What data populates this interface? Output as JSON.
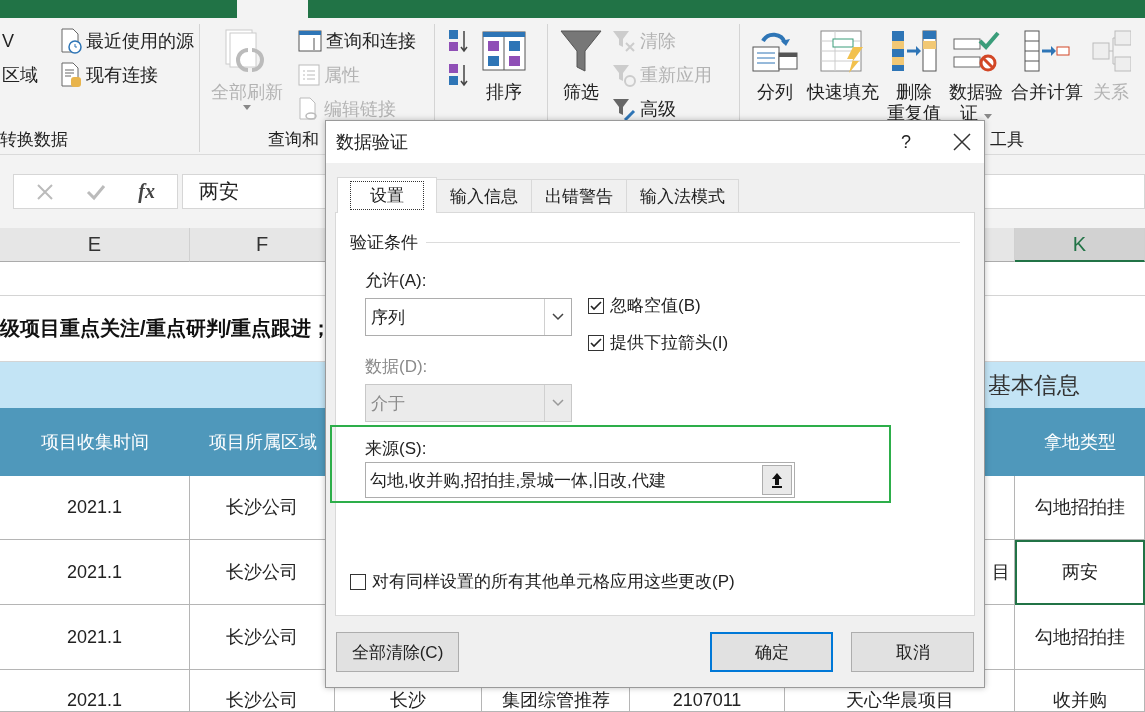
{
  "ribbon": {
    "groups": [
      {
        "label": "转换数据",
        "columns": [
          [
            {
              "kind": "small",
              "text": "V",
              "disabled": false
            },
            {
              "kind": "small",
              "text": "区域",
              "disabled": false
            }
          ],
          [
            {
              "kind": "small",
              "text": "最近使用的源",
              "disabled": false
            },
            {
              "kind": "small",
              "text": "现有连接",
              "disabled": false
            }
          ]
        ]
      },
      {
        "label": "查询和",
        "columns": [
          [
            {
              "kind": "large",
              "text": "全部刷新",
              "disabled": true,
              "menu": true
            }
          ],
          [
            {
              "kind": "small",
              "text": "查询和连接",
              "disabled": false
            },
            {
              "kind": "small",
              "text": "属性",
              "disabled": true
            },
            {
              "kind": "small",
              "text": "编辑链接",
              "disabled": true
            }
          ]
        ]
      },
      {
        "columns": [
          [
            {
              "kind": "icon"
            },
            {
              "kind": "icon"
            }
          ],
          [
            {
              "kind": "large",
              "text": "排序",
              "disabled": false,
              "menu": false
            }
          ]
        ]
      },
      {
        "columns": [
          [
            {
              "kind": "large",
              "text": "筛选",
              "disabled": false,
              "menu": false
            }
          ],
          [
            {
              "kind": "small",
              "text": "清除",
              "disabled": true
            },
            {
              "kind": "small",
              "text": "重新应用",
              "disabled": true
            },
            {
              "kind": "small",
              "text": "高级",
              "disabled": false
            }
          ]
        ]
      },
      {
        "label": "工具",
        "columns": [
          [
            {
              "kind": "large",
              "text": "分列",
              "disabled": false,
              "menu": false
            }
          ],
          [
            {
              "kind": "large",
              "text": "快速填充",
              "disabled": false,
              "menu": false
            }
          ],
          [
            {
              "kind": "large",
              "lines": [
                "删除",
                "重复值"
              ],
              "disabled": false,
              "menu": false
            }
          ],
          [
            {
              "kind": "large",
              "lines": [
                "数据验",
                "证"
              ],
              "disabled": false,
              "menu": true
            }
          ],
          [
            {
              "kind": "large",
              "text": "合并计算",
              "disabled": false,
              "menu": false
            }
          ],
          [
            {
              "kind": "large",
              "text": "关系",
              "disabled": true,
              "menu": false
            }
          ]
        ]
      }
    ]
  },
  "formula_bar": {
    "function_label": "fx",
    "value": "两安"
  },
  "sheet": {
    "columns": [
      {
        "label": "E",
        "selected": false
      },
      {
        "label": "F",
        "selected": false
      },
      {
        "label": "K",
        "selected": true
      }
    ],
    "note": "级项目重点关注/重点研判/重点跟进；",
    "section_title": "基本信息",
    "header_row": [
      "项目收集时间",
      "项目所属区域",
      "拿地类型"
    ],
    "rows": [
      {
        "e": "2021.1",
        "f": "长沙公司",
        "k": {
          "text": "勾地招拍挂",
          "selected": false
        }
      },
      {
        "e": "2021.1",
        "f": "长沙公司",
        "j": "目",
        "k": {
          "text": "两安",
          "selected": true
        }
      },
      {
        "e": "2021.1",
        "f": "长沙公司",
        "k": {
          "text": "勾地招拍挂",
          "selected": false
        }
      },
      {
        "e": "2021.1",
        "f": "长沙公司",
        "g": "长沙",
        "h": "集团综管推荐",
        "i": "2107011",
        "j": "天心华晨项目",
        "k": {
          "text": "收并购",
          "selected": false
        }
      }
    ]
  },
  "dialog": {
    "title": "数据验证",
    "help": "?",
    "tabs": [
      {
        "label": "设置",
        "selected": true
      },
      {
        "label": "输入信息",
        "selected": false
      },
      {
        "label": "出错警告",
        "selected": false
      },
      {
        "label": "输入法模式",
        "selected": false
      }
    ],
    "group_label": "验证条件",
    "allow": {
      "label": "允许(A):",
      "value": "序列",
      "disabled": false
    },
    "data": {
      "label": "数据(D):",
      "value": "介于",
      "disabled": true
    },
    "checkboxes": [
      {
        "label": "忽略空值(B)",
        "checked": true
      },
      {
        "label": "提供下拉箭头(I)",
        "checked": true
      }
    ],
    "source": {
      "label": "来源(S):",
      "value": "勾地,收并购,招拍挂,景城一体,旧改,代建"
    },
    "apply_all": {
      "label": "对有同样设置的所有其他单元格应用这些更改(P)",
      "checked": false
    },
    "buttons": [
      {
        "label": "全部清除(C)",
        "default": false
      },
      {
        "label": "确定",
        "default": true
      },
      {
        "label": "取消",
        "default": false
      }
    ]
  }
}
